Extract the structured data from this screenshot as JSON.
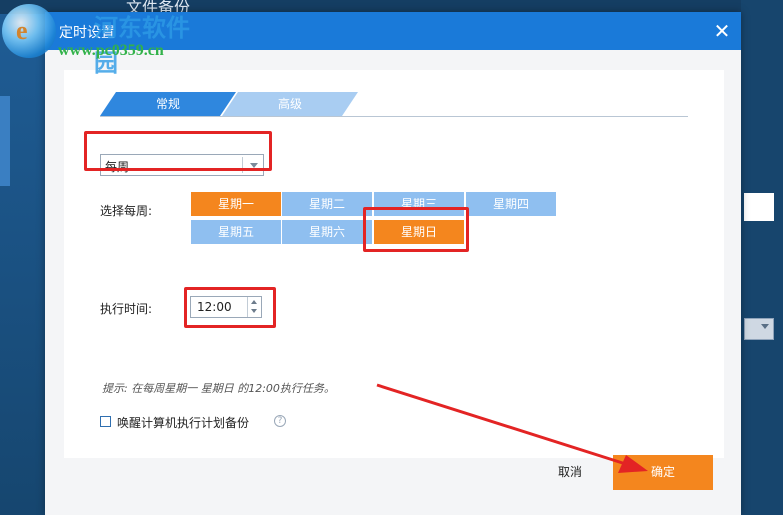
{
  "background_app": {
    "title": "文件备份"
  },
  "watermark": {
    "site": "河东软件园",
    "url": "www.pc0359.cn"
  },
  "dialog": {
    "title": "定时设置",
    "close_icon": "close-icon",
    "tabs": [
      {
        "label": "常规",
        "active": true
      },
      {
        "label": "高级",
        "active": false
      }
    ],
    "frequency": {
      "selected": "每周"
    },
    "weekday_label": "选择每周:",
    "weekdays": [
      {
        "label": "星期一",
        "selected": true
      },
      {
        "label": "星期二",
        "selected": false
      },
      {
        "label": "星期三",
        "selected": false
      },
      {
        "label": "星期四",
        "selected": false
      },
      {
        "label": "星期五",
        "selected": false
      },
      {
        "label": "星期六",
        "selected": false
      },
      {
        "label": "星期日",
        "selected": true
      }
    ],
    "time_label": "执行时间:",
    "time_value": "12:00",
    "hint": "提示: 在每周星期一 星期日 的12:00执行任务。",
    "wake_label": "唤醒计算机执行计划备份",
    "wake_checked": false,
    "cancel_label": "取消",
    "ok_label": "确定"
  },
  "colors": {
    "header": "#1a7ad9",
    "selected_day": "#f4861e",
    "unselected_day": "#8fbff0",
    "highlight": "#e32424"
  }
}
